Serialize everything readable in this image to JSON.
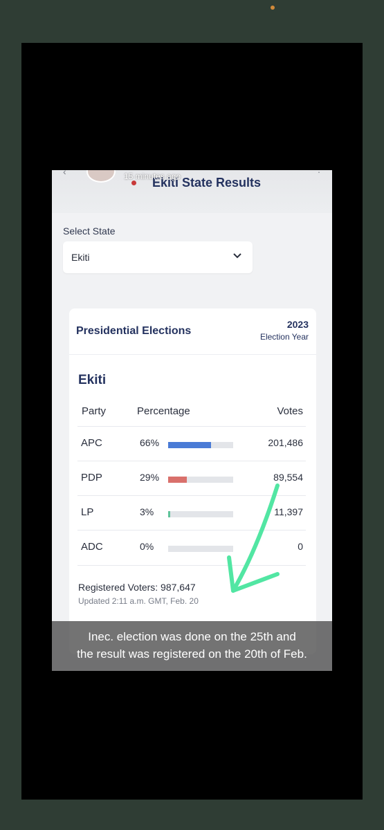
{
  "story": {
    "age": "15 minutes ago"
  },
  "app": {
    "title": "Ekiti State Results"
  },
  "selector": {
    "label": "Select State",
    "selected_value": "Ekiti"
  },
  "card": {
    "title": "Presidential Elections",
    "year": "2023",
    "year_label": "Election Year",
    "state_name": "Ekiti",
    "columns": [
      "Party",
      "Percentage",
      "Votes"
    ],
    "rows": [
      {
        "party": "APC",
        "percent": "66%",
        "share": 0.66,
        "votes": "201,486",
        "color": "#4a7bd6"
      },
      {
        "party": "PDP",
        "percent": "29%",
        "share": 0.29,
        "votes": "89,554",
        "color": "#d9706b"
      },
      {
        "party": "LP",
        "percent": "3%",
        "share": 0.03,
        "votes": "11,397",
        "color": "#5fc39a"
      },
      {
        "party": "ADC",
        "percent": "0%",
        "share": 0,
        "votes": "0",
        "color": "#cccccc"
      }
    ],
    "registered_voters": "Registered Voters: 987,647",
    "updated": "Updated 2:11 a.m. GMT, Feb. 20"
  },
  "caption": {
    "line1": "Inec.     election was done on the 25th and",
    "line2": "the result was registered on the 20th of Feb."
  },
  "colors": {
    "page_bg": "#2f3d34",
    "title": "#24325f",
    "arrow": "#52e6a3"
  }
}
